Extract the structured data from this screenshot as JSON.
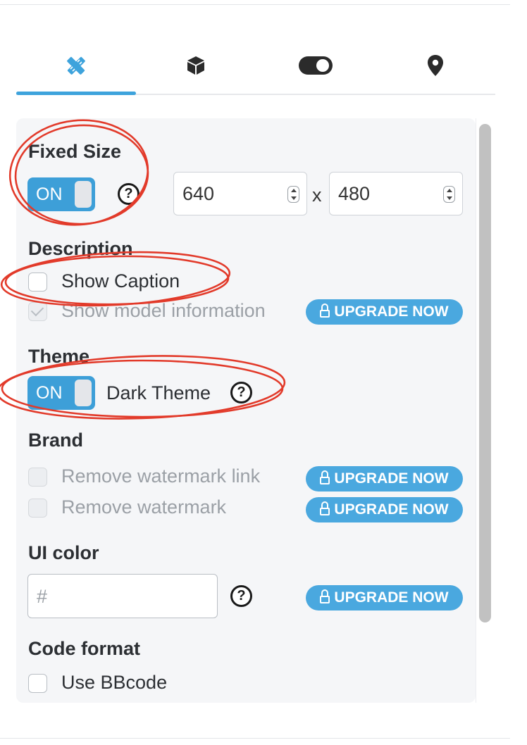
{
  "tabs": [
    {
      "icon": "pencil-ruler-icon",
      "active": true
    },
    {
      "icon": "cube-icon",
      "active": false
    },
    {
      "icon": "toggle-icon",
      "active": false
    },
    {
      "icon": "map-pin-icon",
      "active": false
    }
  ],
  "colors": {
    "accent": "#3d9fd8",
    "upgrade": "#4aa8df",
    "annotation": "#e23a2a",
    "panel": "#f5f6f8"
  },
  "fixed_size": {
    "heading": "Fixed Size",
    "toggle_label": "ON",
    "help": "?",
    "width_value": "640",
    "separator": "x",
    "height_value": "480"
  },
  "description": {
    "heading": "Description",
    "show_caption": {
      "label": "Show Caption",
      "checked": false
    },
    "show_model_info": {
      "label": "Show model information",
      "checked": true,
      "disabled": true
    },
    "upgrade_label": "UPGRADE NOW"
  },
  "theme": {
    "heading": "Theme",
    "toggle_label": "ON",
    "label": "Dark Theme",
    "help": "?"
  },
  "brand": {
    "heading": "Brand",
    "remove_watermark_link": {
      "label": "Remove watermark link",
      "upgrade_label": "UPGRADE NOW"
    },
    "remove_watermark": {
      "label": "Remove watermark",
      "upgrade_label": "UPGRADE NOW"
    }
  },
  "ui_color": {
    "heading": "UI color",
    "placeholder": "#",
    "help": "?",
    "upgrade_label": "UPGRADE NOW"
  },
  "code_format": {
    "heading": "Code format",
    "use_bbcode": {
      "label": "Use BBcode",
      "checked": false
    }
  }
}
